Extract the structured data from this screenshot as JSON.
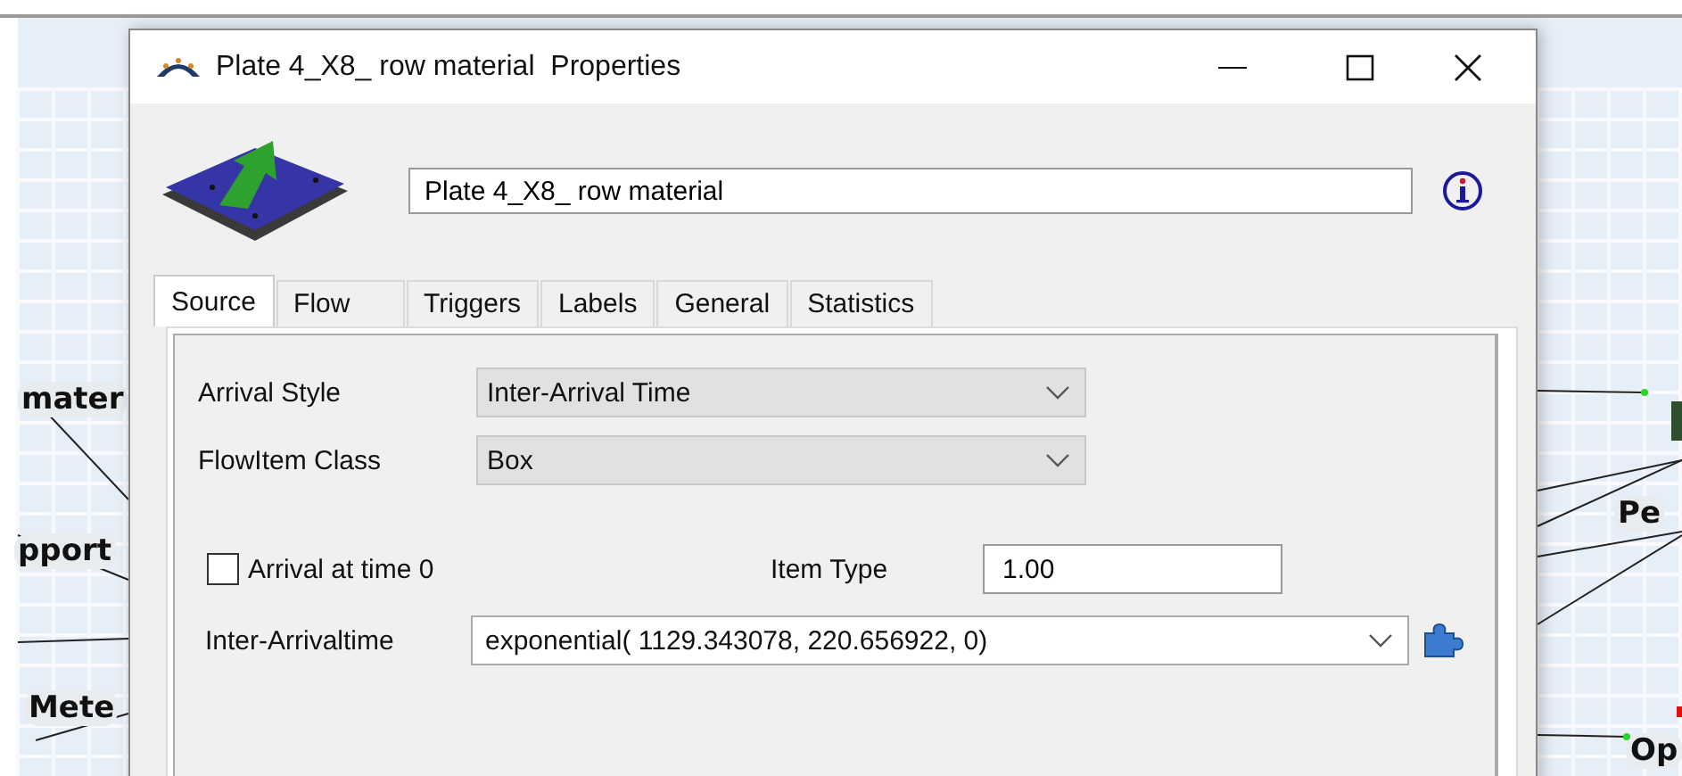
{
  "canvas": {
    "node_labels": [
      {
        "text": "mater"
      },
      {
        "text": "pport"
      },
      {
        "text": "Mete"
      },
      {
        "text": "Pe"
      },
      {
        "text": "Op"
      }
    ]
  },
  "window": {
    "title": "Plate 4_X8_ row material  Properties"
  },
  "name_field": {
    "value": "Plate 4_X8_ row material"
  },
  "tabs": [
    {
      "label": "Source",
      "selected": true
    },
    {
      "label": "Flow",
      "selected": false
    },
    {
      "label": "Triggers",
      "selected": false
    },
    {
      "label": "Labels",
      "selected": false
    },
    {
      "label": "General",
      "selected": false
    },
    {
      "label": "Statistics",
      "selected": false
    }
  ],
  "arrival_style": {
    "label": "Arrival Style",
    "value": "Inter-Arrival Time"
  },
  "flowitem_class": {
    "label": "FlowItem Class",
    "value": "Box"
  },
  "arrival_at_time_0": {
    "label": "Arrival at time 0",
    "checked": false
  },
  "item_type": {
    "label": "Item Type",
    "value": "1.00"
  },
  "inter_arrivaltime": {
    "label": "Inter-Arrivaltime",
    "value": "exponential( 1129.343078, 220.656922, 0)"
  }
}
